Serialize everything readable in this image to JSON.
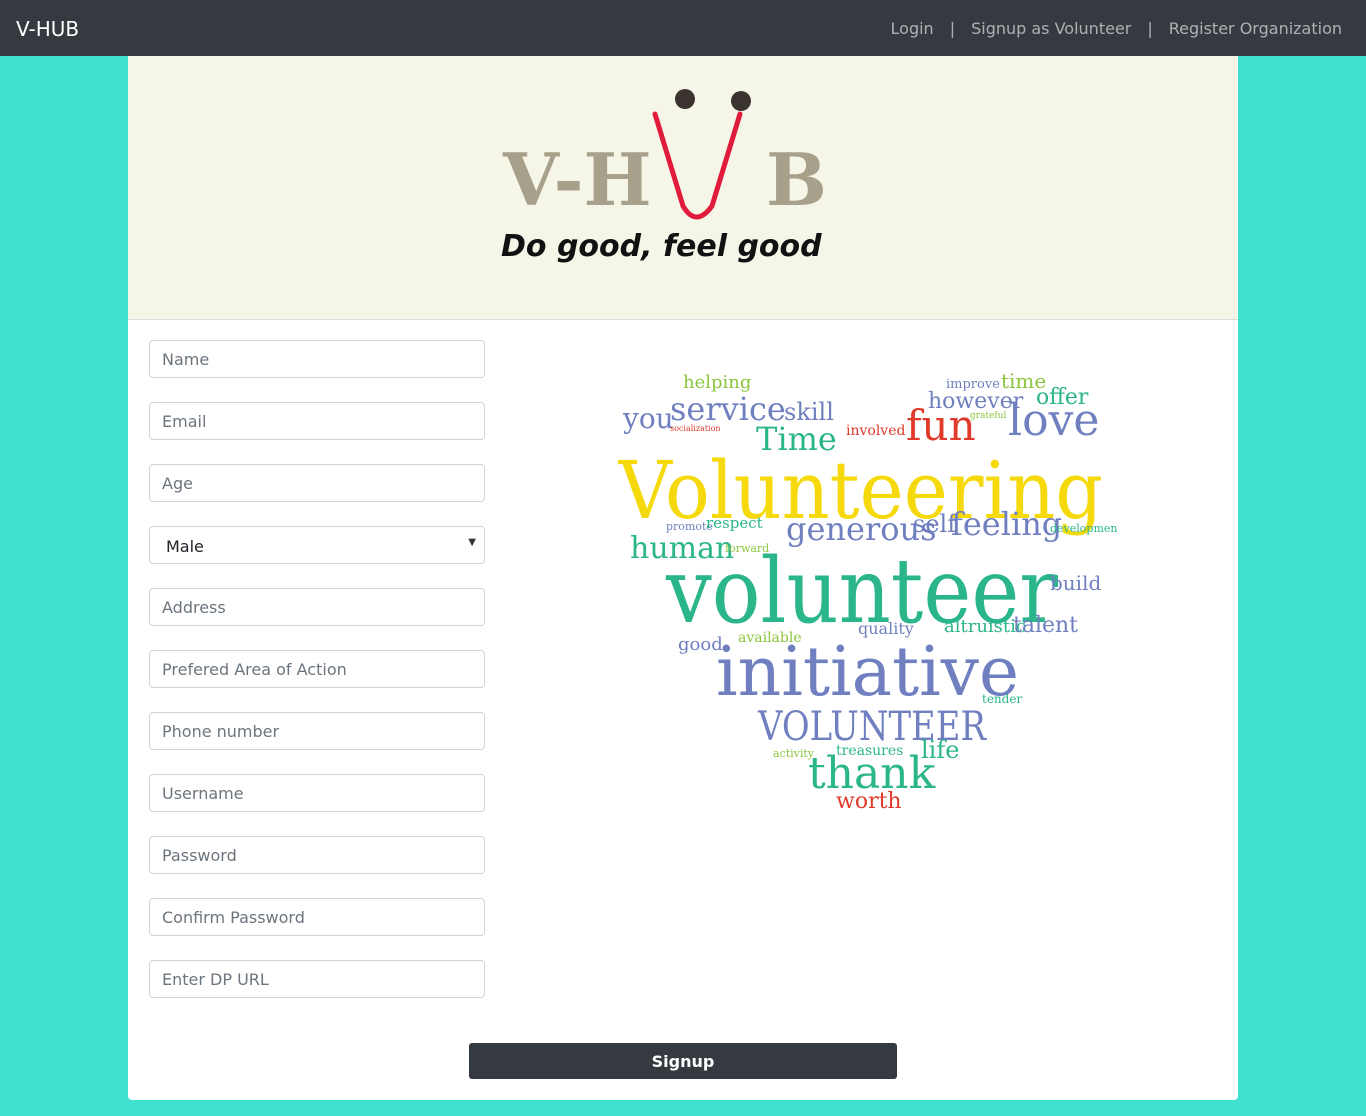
{
  "navbar": {
    "brand": "V-HUB",
    "links": [
      "Login",
      "Signup as Volunteer",
      "Register Organization"
    ],
    "separator": "|"
  },
  "banner": {
    "logo_text": "V-H",
    "logo_text_end": "B",
    "tagline": "Do good, feel good"
  },
  "form": {
    "name_placeholder": "Name",
    "email_placeholder": "Email",
    "age_placeholder": "Age",
    "gender_selected": "Male",
    "address_placeholder": "Address",
    "area_placeholder": "Prefered Area of Action",
    "phone_placeholder": "Phone number",
    "username_placeholder": "Username",
    "password_placeholder": "Password",
    "confirm_password_placeholder": "Confirm Password",
    "dp_url_placeholder": "Enter DP URL",
    "submit_label": "Signup"
  },
  "wordcloud": {
    "words": {
      "helping": "helping",
      "improve": "improve",
      "time": "time",
      "you": "you",
      "service": "service",
      "skill": "skill",
      "however": "however",
      "offer": "offer",
      "socialization": "socialization",
      "grateful": "grateful",
      "Time": "Time",
      "involved": "involved",
      "fun": "fun",
      "love": "love",
      "Volunteering": "Volunteering",
      "promote": "promote",
      "respect": "respect",
      "generous": "generous",
      "self": "self",
      "feeling": "feeling",
      "development": "development",
      "human": "human",
      "forward": "forward",
      "volunteer": "volunteer",
      "build": "build",
      "good": "good",
      "available": "available",
      "quality": "quality",
      "altruistic": "altruistic",
      "talent": "talent",
      "initiative": "initiative",
      "VOLUNTEER": "VOLUNTEER",
      "tender": "tender",
      "activity": "activity",
      "treasures": "treasures",
      "life": "life",
      "thank": "thank",
      "worth": "worth"
    },
    "colors": {
      "yellow": "#f5d90a",
      "green": "#2bb58a",
      "blue": "#6f7fbf",
      "red": "#e03a2a",
      "lime": "#8cc63f"
    }
  }
}
